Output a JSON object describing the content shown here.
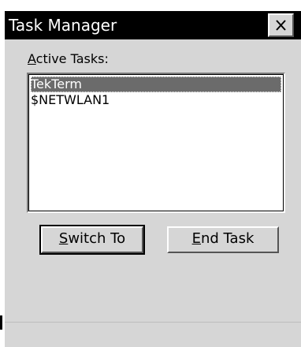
{
  "window": {
    "title": "Task Manager",
    "close_icon": "close-icon"
  },
  "active_tasks": {
    "label_prefix": "A",
    "label_rest": "ctive Tasks:",
    "items": [
      {
        "name": "TekTerm",
        "selected": true
      },
      {
        "name": "$NETWLAN1",
        "selected": false
      }
    ]
  },
  "buttons": {
    "switch_to": {
      "underline": "S",
      "rest": "witch To"
    },
    "end_task": {
      "underline": "E",
      "rest": "nd Task"
    }
  },
  "colors": {
    "titlebar": "#000000",
    "dialog_bg": "#d6d6d6",
    "selection": "#6b6b6b"
  }
}
